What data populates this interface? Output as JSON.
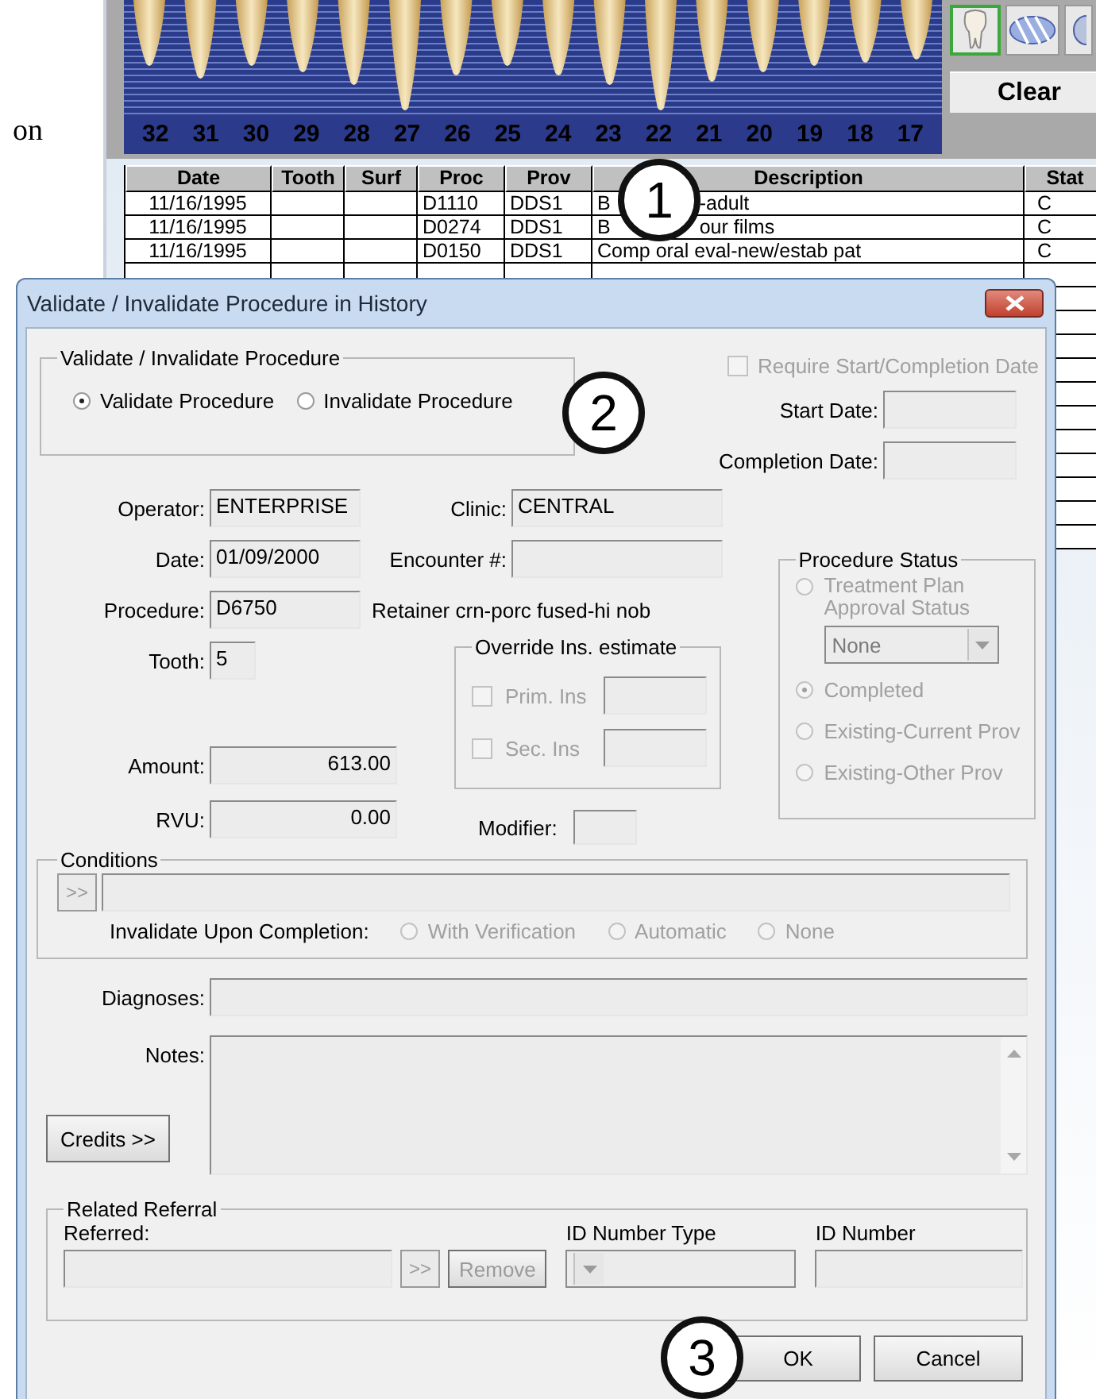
{
  "background_text": "on",
  "tooth_chart": {
    "numbers": [
      "32",
      "31",
      "30",
      "29",
      "28",
      "27",
      "26",
      "25",
      "24",
      "23",
      "22",
      "21",
      "20",
      "19",
      "18",
      "17"
    ]
  },
  "toolbar": {
    "clear_button": "Clear"
  },
  "history_table": {
    "columns": [
      "Date",
      "Tooth",
      "Surf",
      "Proc",
      "Prov",
      "Description",
      "Stat"
    ],
    "rows": [
      {
        "date": "11/16/1995",
        "proc": "D1110",
        "prov": "DDS1",
        "description_parts": [
          "B",
          "-adult"
        ],
        "stat": "C"
      },
      {
        "date": "11/16/1995",
        "proc": "D0274",
        "prov": "DDS1",
        "description_parts": [
          "B",
          "our films"
        ],
        "stat": "C"
      },
      {
        "date": "11/16/1995",
        "proc": "D0150",
        "prov": "DDS1",
        "description_parts": [
          "Comp oral eval-new/estab pat"
        ],
        "stat": "C"
      }
    ]
  },
  "dialog": {
    "title": "Validate / Invalidate Procedure in History",
    "action_group": {
      "title": "Validate / Invalidate Procedure",
      "options": [
        {
          "label": "Validate Procedure",
          "selected": true
        },
        {
          "label": "Invalidate Procedure",
          "selected": false
        }
      ]
    },
    "require_dates": {
      "label": "Require Start/Completion Date",
      "checked": false,
      "disabled": true
    },
    "date_fields": [
      {
        "label": "Start Date:"
      },
      {
        "label": "Completion Date:"
      }
    ],
    "operator": {
      "label": "Operator:",
      "value": "ENTERPRISE"
    },
    "clinic": {
      "label": "Clinic:",
      "value": "CENTRAL"
    },
    "date": {
      "label": "Date:",
      "value": "01/09/2000"
    },
    "encounter": {
      "label": "Encounter #:"
    },
    "procedure": {
      "label": "Procedure:",
      "value": "D6750",
      "description": "Retainer crn-porc fused-hi nob"
    },
    "tooth": {
      "label": "Tooth:",
      "value": "5"
    },
    "amount": {
      "label": "Amount:",
      "value": "613.00"
    },
    "rvu": {
      "label": "RVU:",
      "value": "0.00"
    },
    "modifier": {
      "label": "Modifier:"
    },
    "override": {
      "title": "Override Ins. estimate",
      "items": [
        {
          "label": "Prim. Ins",
          "checked": false,
          "disabled": true
        },
        {
          "label": "Sec. Ins",
          "checked": false,
          "disabled": true
        }
      ]
    },
    "procedure_status": {
      "title": "Procedure Status",
      "approval_select": {
        "value": "None",
        "disabled": true
      },
      "options": [
        {
          "label": "Treatment Plan Approval Status",
          "selected": false,
          "disabled": true
        },
        {
          "label": "Completed",
          "selected": true,
          "disabled": true
        },
        {
          "label": "Existing-Current Prov",
          "selected": false,
          "disabled": true
        },
        {
          "label": "Existing-Other Prov",
          "selected": false,
          "disabled": true
        }
      ]
    },
    "conditions": {
      "title": "Conditions",
      "browse_button": ">>",
      "invalidate_label": "Invalidate Upon Completion:",
      "options": [
        {
          "label": "With Verification",
          "selected": false,
          "disabled": true
        },
        {
          "label": "Automatic",
          "selected": false,
          "disabled": true
        },
        {
          "label": "None",
          "selected": false,
          "disabled": true
        }
      ]
    },
    "diagnoses": {
      "label": "Diagnoses:"
    },
    "notes": {
      "label": "Notes:"
    },
    "credits_button": "Credits >>",
    "referral": {
      "title": "Related Referral",
      "referred_label": "Referred:",
      "browse_button": ">>",
      "remove_button": "Remove",
      "id_type_label": "ID Number Type",
      "id_number_label": "ID Number",
      "disabled": true
    },
    "buttons": [
      "OK",
      "Cancel"
    ]
  },
  "callouts": [
    "1",
    "2",
    "3"
  ]
}
